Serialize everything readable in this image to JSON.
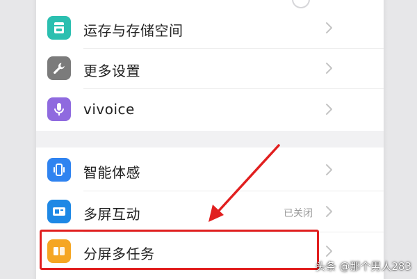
{
  "settings": {
    "items": [
      {
        "label": "运存与存储空间",
        "icon": "storage-icon",
        "color": "#2bbfb0",
        "status": ""
      },
      {
        "label": "更多设置",
        "icon": "wrench-icon",
        "color": "#7b7b7b",
        "status": ""
      },
      {
        "label": "vivoice",
        "icon": "microphone-icon",
        "color": "#8f6adf",
        "status": ""
      },
      {
        "label": "智能体感",
        "icon": "phone-motion-icon",
        "color": "#2f83f0",
        "status": ""
      },
      {
        "label": "多屏互动",
        "icon": "screen-cast-icon",
        "color": "#1e88e5",
        "status": "已关闭"
      },
      {
        "label": "分屏多任务",
        "icon": "split-screen-icon",
        "color": "#f5a623",
        "status": ""
      }
    ]
  },
  "annotation": {
    "color": "#e11f1f",
    "highlighted_item": "分屏多任务"
  },
  "watermark": {
    "text": "头条 @那个男人283"
  }
}
